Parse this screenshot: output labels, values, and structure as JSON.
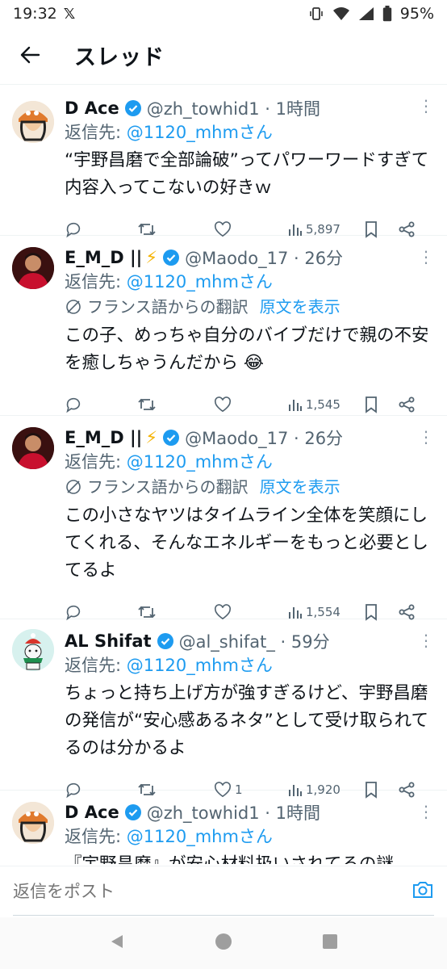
{
  "status_bar": {
    "time": "19:32",
    "app_icon": "x-logo",
    "battery": "95%"
  },
  "header": {
    "title": "スレッド",
    "back_icon": "arrow-left-icon"
  },
  "tweets": [
    {
      "name": "D Ace",
      "handle": "@zh_towhid1 · 1時間",
      "reply_prefix": "返信先: ",
      "reply_to": "@1120_mhmさん",
      "body": "“宇野昌磨で全部論破”ってパワーワードすぎて内容入ってこないの好きｗ",
      "translate": null,
      "replies": "",
      "retweets": "",
      "likes": "",
      "views": "5,897"
    },
    {
      "name": "E_M_D ||",
      "handle": "@Maodo_17 · 26分",
      "reply_prefix": "返信先: ",
      "reply_to": "@1120_mhmさん",
      "translate": "フランス語からの翻訳",
      "show_original": "原文を表示",
      "body": "この子、めっちゃ自分のバイブだけで親の不安を癒しちゃうんだから 😂",
      "replies": "",
      "retweets": "",
      "likes": "",
      "views": "1,545"
    },
    {
      "name": "E_M_D ||",
      "handle": "@Maodo_17 · 26分",
      "reply_prefix": "返信先: ",
      "reply_to": "@1120_mhmさん",
      "translate": "フランス語からの翻訳",
      "show_original": "原文を表示",
      "body": "この小さなヤツはタイムライン全体を笑顔にしてくれる、そんなエネルギーをもっと必要としてるよ",
      "replies": "",
      "retweets": "",
      "likes": "",
      "views": "1,554"
    },
    {
      "name": "AL Shifat",
      "handle": "@al_shifat_ · 59分",
      "reply_prefix": "返信先: ",
      "reply_to": "@1120_mhmさん",
      "translate": null,
      "body": "ちょっと持ち上げ方が強すぎるけど、宇野昌磨の発信が“安心感あるネタ”として受け取られてるのは分かるよ",
      "replies": "",
      "retweets": "",
      "likes": "1",
      "views": "1,920"
    },
    {
      "name": "D Ace",
      "handle": "@zh_towhid1 · 1時間",
      "reply_prefix": "返信先: ",
      "reply_to": "@1120_mhmさん",
      "translate": null,
      "body": "『宇野昌磨』が安心材料扱いされてるの謎",
      "replies": "",
      "retweets": "",
      "likes": "",
      "views": ""
    }
  ],
  "compose": {
    "placeholder": "返信をポスト",
    "camera_icon": "camera-icon"
  },
  "colors": {
    "accent": "#1d9bf0",
    "muted": "#536471",
    "bolt": "#f5b301"
  }
}
